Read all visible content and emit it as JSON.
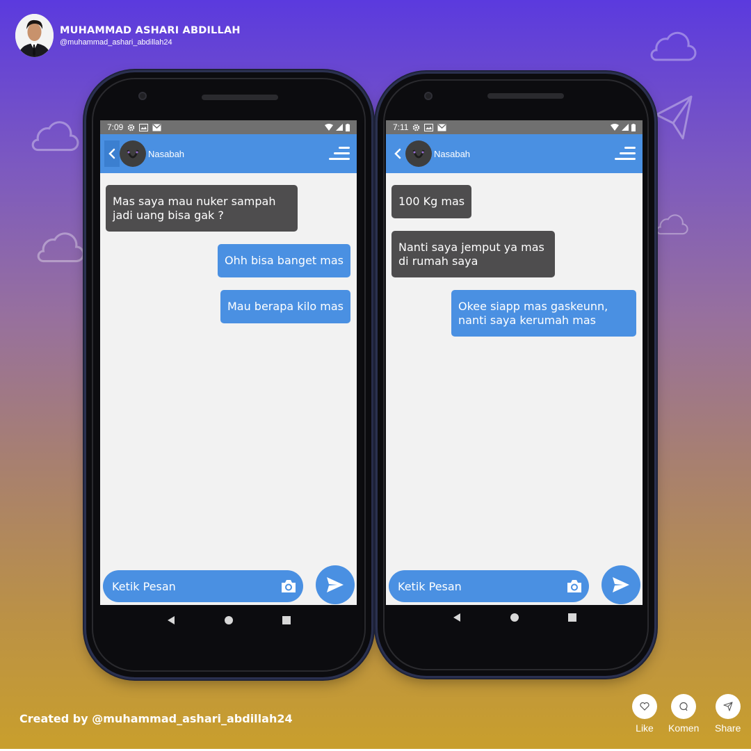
{
  "author": {
    "name": "MUHAMMAD ASHARI ABDILLAH",
    "handle": "@muhammad_ashari_abdillah24"
  },
  "phones": [
    {
      "status_time": "7:09",
      "contact_name": "Nasabah",
      "messages": [
        {
          "side": "in",
          "text": "Mas saya mau nuker sampah jadi uang bisa gak ?"
        },
        {
          "side": "out",
          "text": "Ohh bisa banget mas"
        },
        {
          "side": "out",
          "text": "Mau berapa kilo mas"
        }
      ],
      "input_placeholder": "Ketik Pesan"
    },
    {
      "status_time": "7:11",
      "contact_name": "Nasabah",
      "messages": [
        {
          "side": "in",
          "text": "100 Kg mas"
        },
        {
          "side": "in",
          "text": "Nanti saya jemput ya mas di rumah saya"
        },
        {
          "side": "out",
          "text": "Okee siapp mas gaskeunn, nanti saya kerumah mas"
        }
      ],
      "input_placeholder": "Ketik Pesan"
    }
  ],
  "footer": {
    "credit": "Created by @muhammad_ashari_abdillah24",
    "like_label": "Like",
    "comment_label": "Komen",
    "share_label": "Share"
  },
  "colors": {
    "accent": "#4a90e2",
    "bubble_in": "#4e4d4e",
    "screen_bg": "#f2f2f2",
    "status_bar": "#707070"
  },
  "icons": {
    "back": "chevron-left-icon",
    "menu": "sort-lines-icon",
    "camera": "camera-icon",
    "send": "send-icon",
    "like": "heart-icon",
    "comment": "comment-icon",
    "share": "paper-plane-icon"
  }
}
